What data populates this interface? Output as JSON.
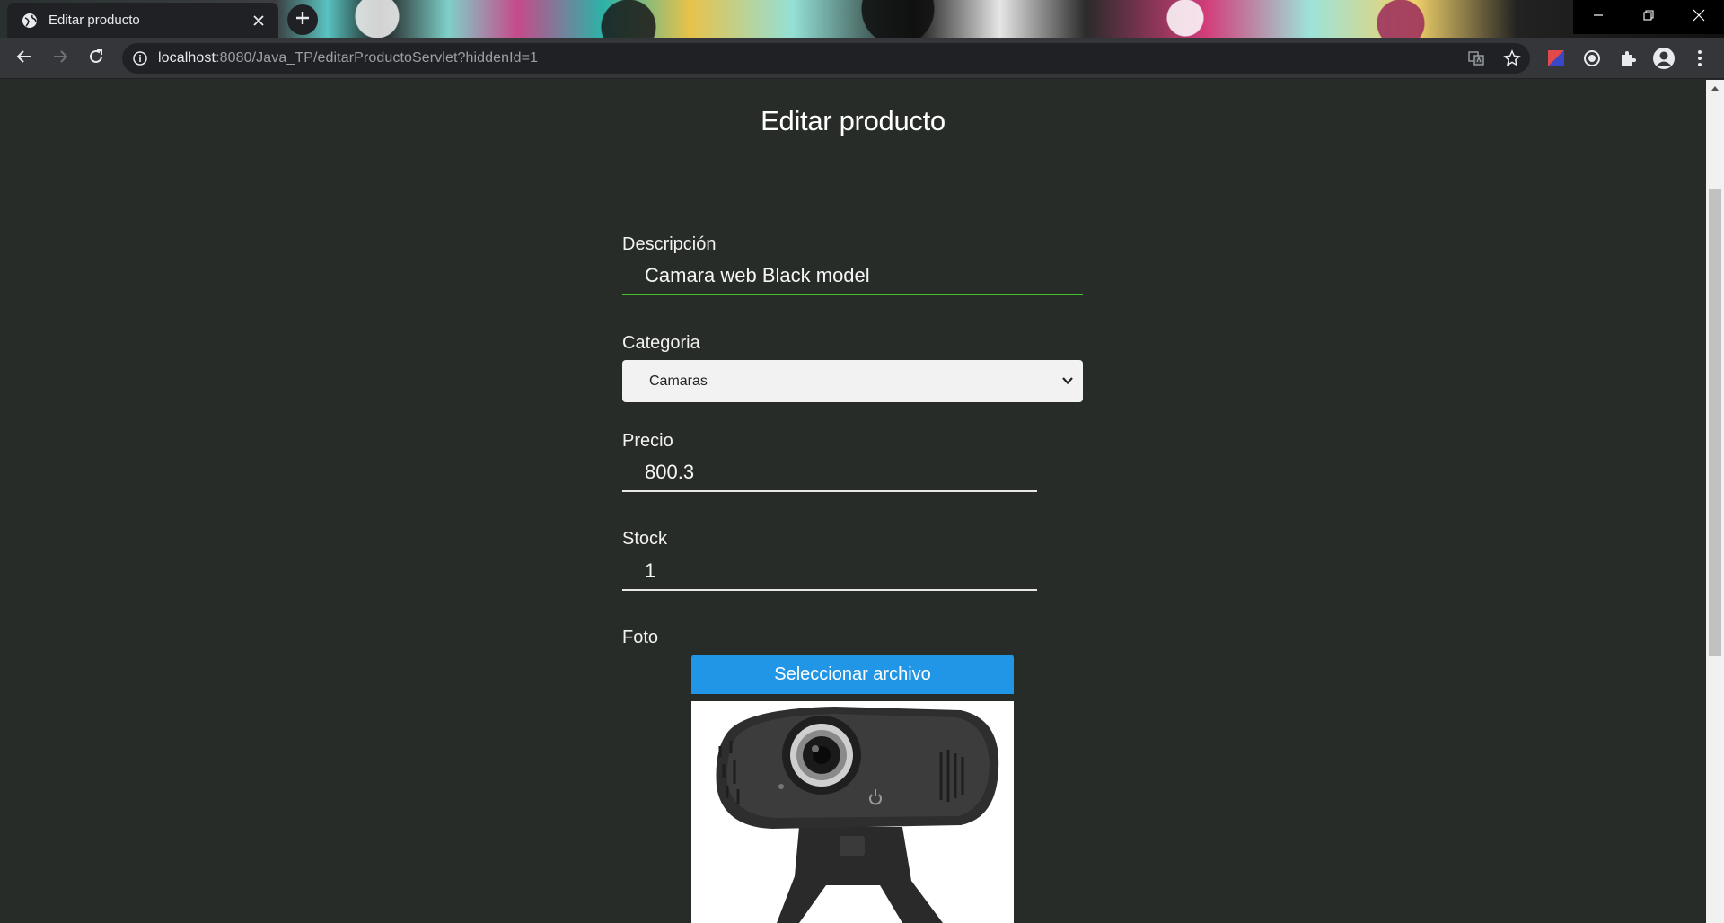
{
  "browser": {
    "tab": {
      "title": "Editar producto",
      "favicon": "globe-icon",
      "close_icon": "close-icon"
    },
    "new_tab_icon": "plus-icon",
    "window_controls": [
      "minimize-icon",
      "restore-icon",
      "close-icon"
    ],
    "nav": {
      "back": "back-arrow-icon",
      "forward": "forward-arrow-icon",
      "reload": "reload-icon"
    },
    "omnibox": {
      "info_icon": "info-icon",
      "url_host": "localhost",
      "url_path": ":8080/Java_TP/editarProductoServlet?hiddenId=1",
      "translate_icon": "translate-icon",
      "bookmark_icon": "star-icon"
    },
    "extensions": [
      "color-extension-icon",
      "record-icon",
      "puzzle-icon",
      "profile-icon",
      "kebab-menu-icon"
    ]
  },
  "page": {
    "title": "Editar producto",
    "fields": {
      "descripcion": {
        "label": "Descripción",
        "value": "Camara web Black model"
      },
      "categoria": {
        "label": "Categoria",
        "selected": "Camaras"
      },
      "precio": {
        "label": "Precio",
        "value": "800.3"
      },
      "stock": {
        "label": "Stock",
        "value": "1"
      },
      "foto": {
        "label": "Foto",
        "button": "Seleccionar archivo",
        "image": "webcam-photo"
      }
    }
  },
  "colors": {
    "page_bg": "#272c28",
    "focus_underline": "#49c22f",
    "file_button": "#2196e6"
  }
}
